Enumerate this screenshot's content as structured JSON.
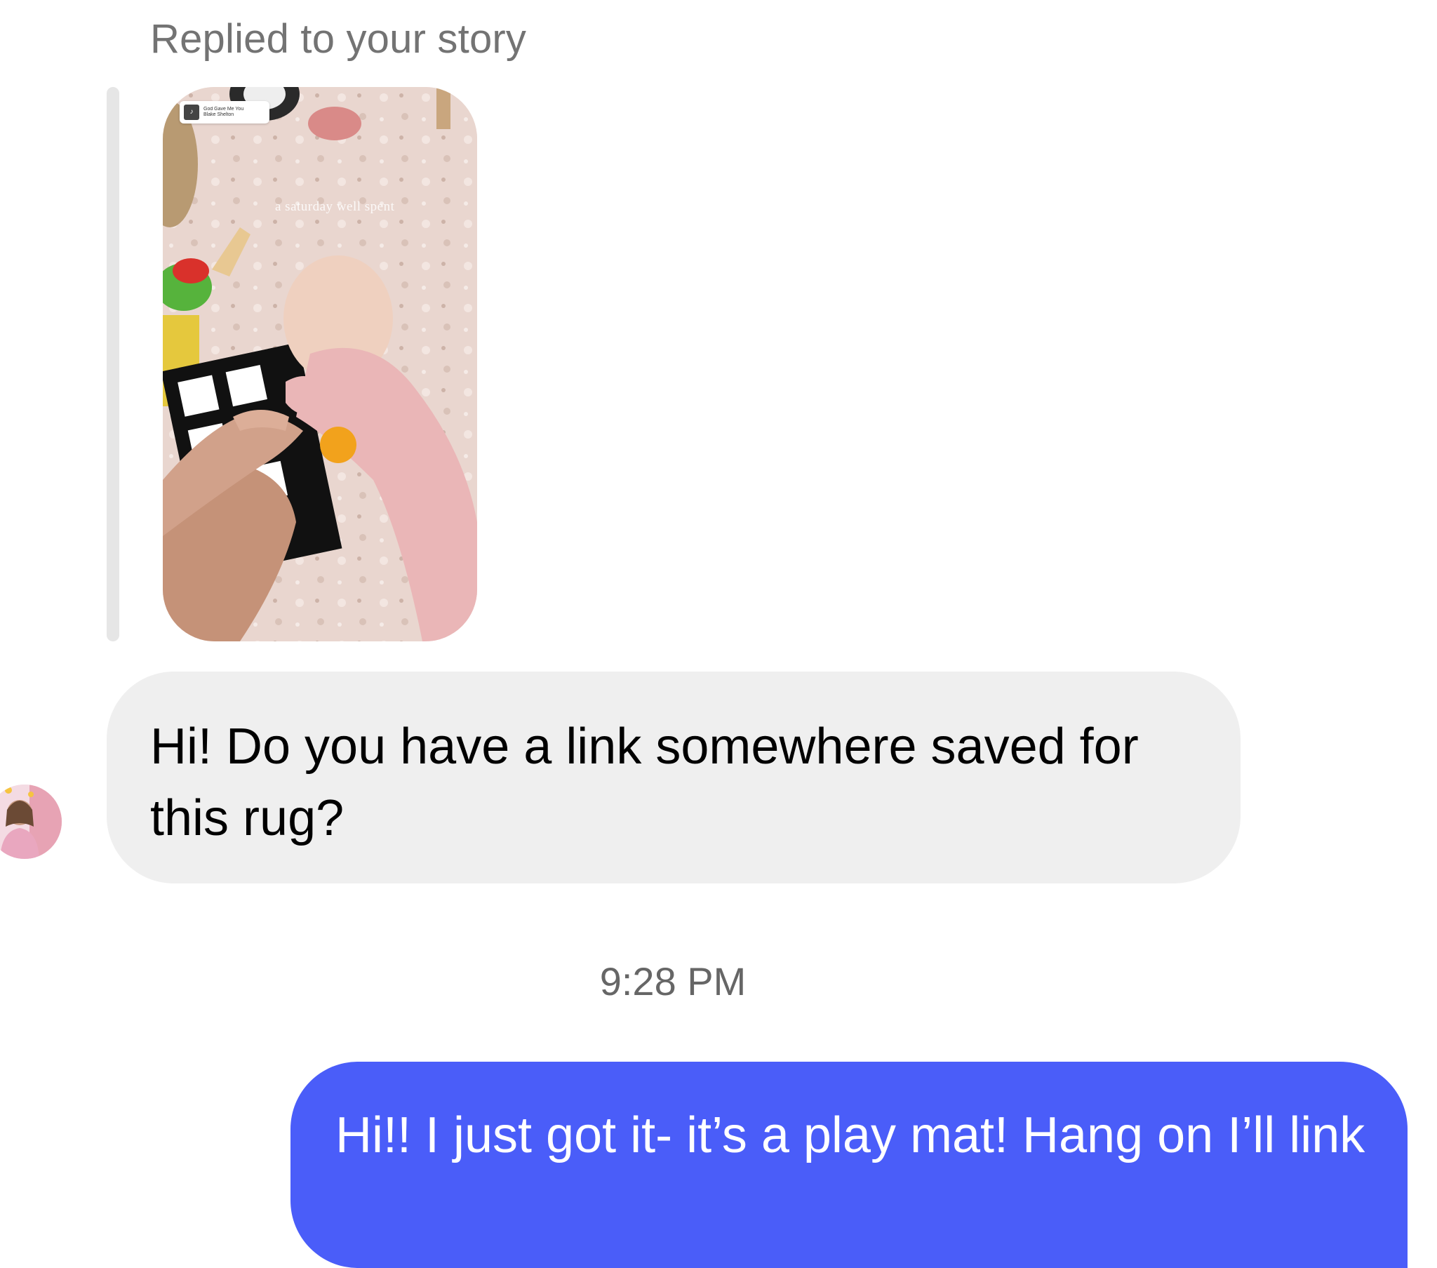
{
  "reply_context": {
    "label": "Replied to your story"
  },
  "story": {
    "music_title": "God Gave Me You",
    "music_artist": "Blake Shelton",
    "caption": "a saturday well spent"
  },
  "messages": [
    {
      "direction": "incoming",
      "text": "Hi! Do you have a link somewhere saved for this rug?"
    },
    {
      "direction": "outgoing",
      "text": "Hi!! I just got it- it’s a play mat! Hang on I’ll link"
    }
  ],
  "timestamp": "9:28 PM",
  "colors": {
    "outgoing_bubble": "#4a5df9",
    "incoming_bubble": "#efefef",
    "muted_text": "#737373"
  }
}
